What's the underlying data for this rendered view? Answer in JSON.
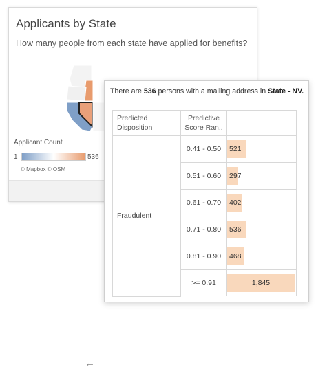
{
  "dashboard": {
    "title": "Applicants by State",
    "subtitle": "How many people from each state have applied for benefits?",
    "legend": {
      "title": "Applicant Count",
      "min": "1",
      "max": "536",
      "colors": {
        "low": "#7f9fc7",
        "mid": "#ffffff",
        "high": "#e89b6d"
      }
    },
    "credits": "© Mapbox  © OSM",
    "back_icon": "←"
  },
  "tooltip": {
    "header_prefix": "There are ",
    "count": "536",
    "header_mid": " persons with a mailing address in ",
    "state_label": "State - NV.",
    "columns": {
      "disposition": "Predicted Disposition",
      "range": "Predictive Score Ran.."
    },
    "disposition": "Fraudulent",
    "bar_color": "#f9d8bc",
    "rows": [
      {
        "range": "0.41 - 0.50",
        "value": 521,
        "label": "521"
      },
      {
        "range": "0.51 - 0.60",
        "value": 297,
        "label": "297"
      },
      {
        "range": "0.61 - 0.70",
        "value": 402,
        "label": "402"
      },
      {
        "range": "0.71 - 0.80",
        "value": 536,
        "label": "536"
      },
      {
        "range": "0.81 - 0.90",
        "value": 468,
        "label": "468"
      },
      {
        "range": ">= 0.91",
        "value": 1845,
        "label": "1,845"
      }
    ]
  }
}
